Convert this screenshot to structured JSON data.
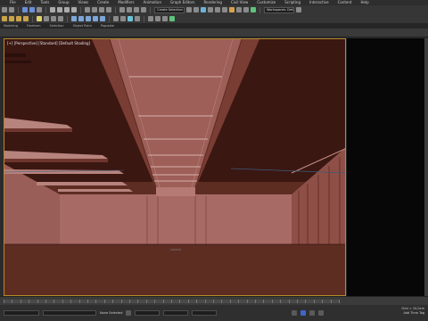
{
  "menu": {
    "items": [
      "File",
      "Edit",
      "Tools",
      "Group",
      "Views",
      "Create",
      "Modifiers",
      "Animation",
      "Graph Editors",
      "Rendering",
      "Civil View",
      "Customize",
      "Scripting",
      "Interactive",
      "Content",
      "Help"
    ]
  },
  "toolbar": {
    "selection_set_placeholder": "Create Selection Se",
    "workspace": "Workspaces: Default"
  },
  "ribbon": {
    "tabs": [
      "Modeling",
      "Freeform",
      "Selection",
      "Object Paint",
      "Populate"
    ]
  },
  "viewport": {
    "label": "[+] [Perspective] [Standard] [Default Shading]"
  },
  "status": {
    "objects": "None Selected",
    "grid": "Grid = 10,0cm",
    "add_time_tag": "Add Time Tag"
  },
  "colors": {
    "viewport_border": "#b58a2a",
    "wall": "#a86a65",
    "floor": "#5d2d22",
    "accent_blue": "#3d66c9"
  }
}
